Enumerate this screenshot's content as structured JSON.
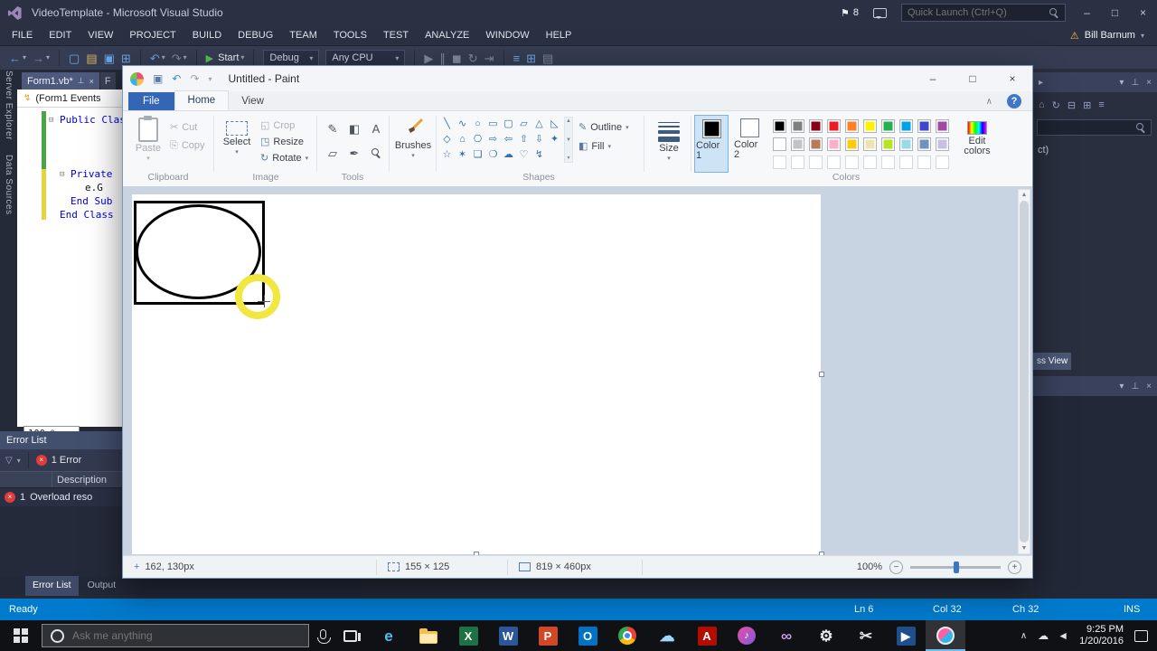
{
  "colors": {
    "vs_accent": "#007acc",
    "selection_ring": "#f2e73e",
    "paint_file_tab": "#3466b5"
  },
  "icons": {
    "caret_down": "▾",
    "caret_right": "▸",
    "chevron_up": "∧",
    "back_arrow": "←",
    "forward_arrow": "→",
    "new_file": "▢",
    "open_file": "▤",
    "save": "▣",
    "save_all": "⊞",
    "undo": "↶",
    "redo": "↷",
    "play": "▶",
    "pause": "∥",
    "stop": "◼",
    "refresh": "↻",
    "step": "⇥",
    "list": "≡",
    "flag": "⚑",
    "warning": "⚠",
    "pin": "⊥",
    "close": "×",
    "minimize": "–",
    "maximize": "□",
    "help": "?",
    "lightning": "↯",
    "fold_collapse": "⊟",
    "scroll_up": "▲",
    "scroll_down": "▼",
    "filter": "▽",
    "scissors": "✂",
    "copy": "⎘",
    "crop": "◱",
    "resize": "◳",
    "rotate": "↻",
    "pencil": "✎",
    "fill_bucket": "◧",
    "home": "⌂",
    "plus": "+",
    "minus": "−",
    "crosshair": "+"
  },
  "vs": {
    "window_title": "VideoTemplate - Microsoft Visual Studio",
    "titlebar": {
      "notification_count": "8",
      "quick_launch_placeholder": "Quick Launch (Ctrl+Q)"
    },
    "menu": [
      "FILE",
      "EDIT",
      "VIEW",
      "PROJECT",
      "BUILD",
      "DEBUG",
      "TEAM",
      "TOOLS",
      "TEST",
      "ANALYZE",
      "WINDOW",
      "HELP"
    ],
    "account_name": "Bill Barnum",
    "toolbar": {
      "start": "Start",
      "configuration": "Debug",
      "platform": "Any CPU"
    },
    "side_tabs": [
      "Server Explorer",
      "Data Sources"
    ],
    "editor": {
      "tab1": "Form1.vb*",
      "tab2_fragment": "F",
      "navigation_dropdown": "(Form1 Events",
      "code_line1": "Public Clas",
      "code_line2": "Private",
      "code_line3": "e.G",
      "code_line4": "End Sub",
      "code_line5": "End Class",
      "zoom": "100 %"
    },
    "error_list": {
      "title": "Error List",
      "error_count": "1 Error",
      "description_column": "Description",
      "row_num": "1",
      "row_description": "Overload reso"
    },
    "panel_tabs": {
      "error_list": "Error List",
      "output": "Output"
    },
    "solution_explorer": {
      "item_fragment": "ct)",
      "class_view_tab_fragment": "ss View"
    },
    "statusbar": {
      "message": "Ready",
      "line": "Ln 6",
      "column": "Col 32",
      "character": "Ch 32",
      "mode": "INS"
    }
  },
  "paint": {
    "window_title": "Untitled - Paint",
    "tabs": {
      "file": "File",
      "home": "Home",
      "view": "View"
    },
    "clipboard_group": {
      "label": "Clipboard",
      "paste": "Paste",
      "cut": "Cut",
      "copy": "Copy"
    },
    "image_group": {
      "label": "Image",
      "select": "Select",
      "crop": "Crop",
      "resize": "Resize",
      "rotate": "Rotate"
    },
    "tools_group": {
      "label": "Tools",
      "tools": [
        {
          "name": "pencil",
          "glyph": "✎"
        },
        {
          "name": "fill",
          "glyph": "◧"
        },
        {
          "name": "text",
          "glyph": "A"
        },
        {
          "name": "eraser",
          "glyph": "▱"
        },
        {
          "name": "color-picker",
          "glyph": "✒"
        },
        {
          "name": "magnifier",
          "glyph": ""
        }
      ]
    },
    "brushes_label": "Brushes",
    "shapes_group": {
      "label": "Shapes",
      "outline": "Outline",
      "fill": "Fill",
      "shapes": [
        {
          "name": "line",
          "glyph": "╲"
        },
        {
          "name": "curve",
          "glyph": "∿"
        },
        {
          "name": "oval",
          "glyph": "○"
        },
        {
          "name": "rectangle",
          "glyph": "▭"
        },
        {
          "name": "rounded-rectangle",
          "glyph": "▢"
        },
        {
          "name": "polygon",
          "glyph": "▱"
        },
        {
          "name": "triangle",
          "glyph": "△"
        },
        {
          "name": "right-triangle",
          "glyph": "◺"
        },
        {
          "name": "diamond",
          "glyph": "◇"
        },
        {
          "name": "pentagon",
          "glyph": "⌂"
        },
        {
          "name": "hexagon",
          "glyph": "⎔"
        },
        {
          "name": "right-arrow",
          "glyph": "⇨"
        },
        {
          "name": "left-arrow",
          "glyph": "⇦"
        },
        {
          "name": "up-arrow",
          "glyph": "⇧"
        },
        {
          "name": "down-arrow",
          "glyph": "⇩"
        },
        {
          "name": "four-point-star",
          "glyph": "✦"
        },
        {
          "name": "five-point-star",
          "glyph": "☆"
        },
        {
          "name": "six-point-star",
          "glyph": "✶"
        },
        {
          "name": "rounded-callout",
          "glyph": "❏"
        },
        {
          "name": "oval-callout",
          "glyph": "❍"
        },
        {
          "name": "cloud-callout",
          "glyph": "☁"
        },
        {
          "name": "heart",
          "glyph": "♡"
        },
        {
          "name": "lightning",
          "glyph": "↯"
        }
      ]
    },
    "size_label": "Size",
    "colors_group": {
      "label": "Colors",
      "color1_label": "Color 1",
      "color2_label": "Color 2",
      "edit_colors_label": "Edit colors",
      "color1": "#000000",
      "color2": "#ffffff",
      "palette_row1": [
        "#000000",
        "#7f7f7f",
        "#880015",
        "#ed1c24",
        "#ff7f27",
        "#fff200",
        "#22b14c",
        "#00a2e8",
        "#3f48cc",
        "#a349a4"
      ],
      "palette_row2": [
        "#ffffff",
        "#c3c3c3",
        "#b97a57",
        "#ffaec9",
        "#ffc90e",
        "#efe4b0",
        "#b5e61d",
        "#99d9ea",
        "#7092be",
        "#c8bfe7"
      ],
      "empty_slots": 10
    },
    "statusbar": {
      "cursor_position": "162, 130px",
      "selection_size": "155 × 125",
      "image_size": "819 × 460px",
      "zoom": "100%"
    }
  },
  "taskbar": {
    "search_placeholder": "Ask me anything",
    "apps": [
      {
        "name": "edge",
        "glyph": "e",
        "fg": "#4ec1f0"
      },
      {
        "name": "file-explorer"
      },
      {
        "name": "excel",
        "glyph": "X",
        "fg": "#ffffff",
        "bg": "#1e7145"
      },
      {
        "name": "word",
        "glyph": "W",
        "fg": "#ffffff",
        "bg": "#2b579a"
      },
      {
        "name": "powerpoint",
        "glyph": "P",
        "fg": "#ffffff",
        "bg": "#d24726"
      },
      {
        "name": "outlook",
        "glyph": "O",
        "fg": "#ffffff",
        "bg": "#0072c6"
      },
      {
        "name": "chrome"
      },
      {
        "name": "onedrive",
        "glyph": "☁",
        "fg": "#9fd8ff"
      },
      {
        "name": "adobe-reader",
        "glyph": "A",
        "fg": "#ffffff",
        "bg": "#b30c00"
      },
      {
        "name": "groove-music",
        "glyph": "♪"
      },
      {
        "name": "visual-studio",
        "glyph": "∞",
        "fg": "#c299e0"
      },
      {
        "name": "settings",
        "glyph": "⚙",
        "fg": "#e6e9ee"
      },
      {
        "name": "snipping-tool",
        "glyph": "✂",
        "fg": "#dfe5ec"
      },
      {
        "name": "movies-tv",
        "glyph": "▶",
        "fg": "#ffffff",
        "bg": "#1f4e8c"
      },
      {
        "name": "paint",
        "active": true
      }
    ],
    "tray": {
      "icons": [
        {
          "name": "onedrive",
          "glyph": "☁"
        },
        {
          "name": "volume",
          "glyph": "◄"
        }
      ],
      "time": "9:25 PM",
      "date": "1/20/2016"
    }
  }
}
